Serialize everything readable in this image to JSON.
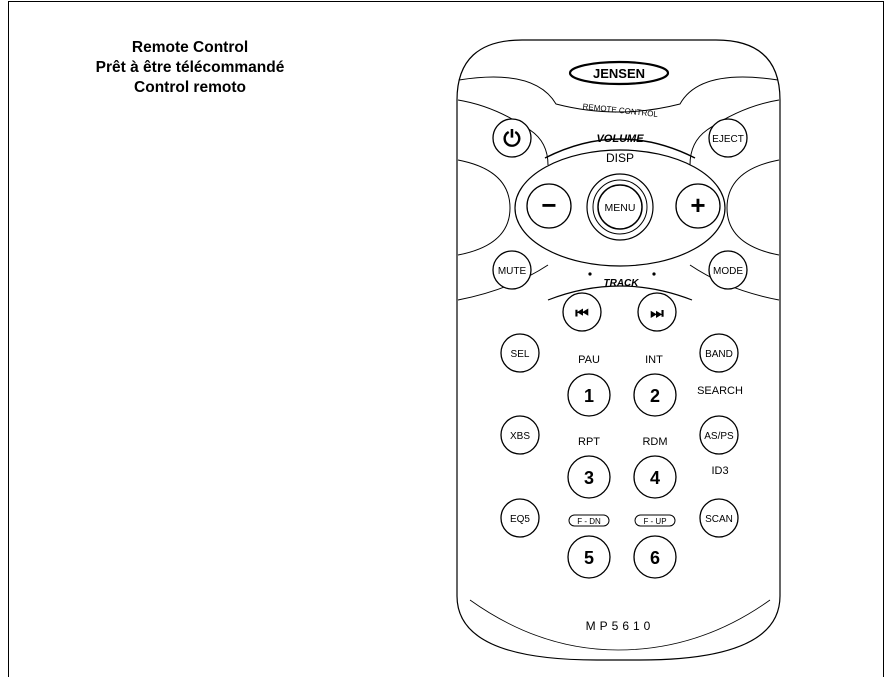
{
  "heading": {
    "english": "Remote Control",
    "french": "Prêt à être télécommandé",
    "spanish": "Control remoto"
  },
  "remote": {
    "brand": "JENSEN",
    "subtitle": "REMOTE CONTROL",
    "model": "MP5610",
    "volume_label": "VOLUME",
    "track_label": "TRACK",
    "disp_label": "DISP",
    "buttons": {
      "power_symbol": "⏻",
      "eject": "EJECT",
      "minus": "−",
      "menu": "MENU",
      "plus": "+",
      "mute": "MUTE",
      "mode": "MODE",
      "prev_symbol": "⏮",
      "next_symbol": "⏭",
      "sel": "SEL",
      "band": "BAND",
      "xbs": "XBS",
      "as_ps": "AS/PS",
      "eq5": "EQ5",
      "scan": "SCAN",
      "num1": "1",
      "num2": "2",
      "num3": "3",
      "num4": "4",
      "num5": "5",
      "num6": "6"
    },
    "sublabels": {
      "pau": "PAU",
      "int": "INT",
      "search": "SEARCH",
      "rpt": "RPT",
      "rdm": "RDM",
      "id3": "ID3",
      "f_dn": "F - DN",
      "f_up": "F - UP"
    }
  }
}
